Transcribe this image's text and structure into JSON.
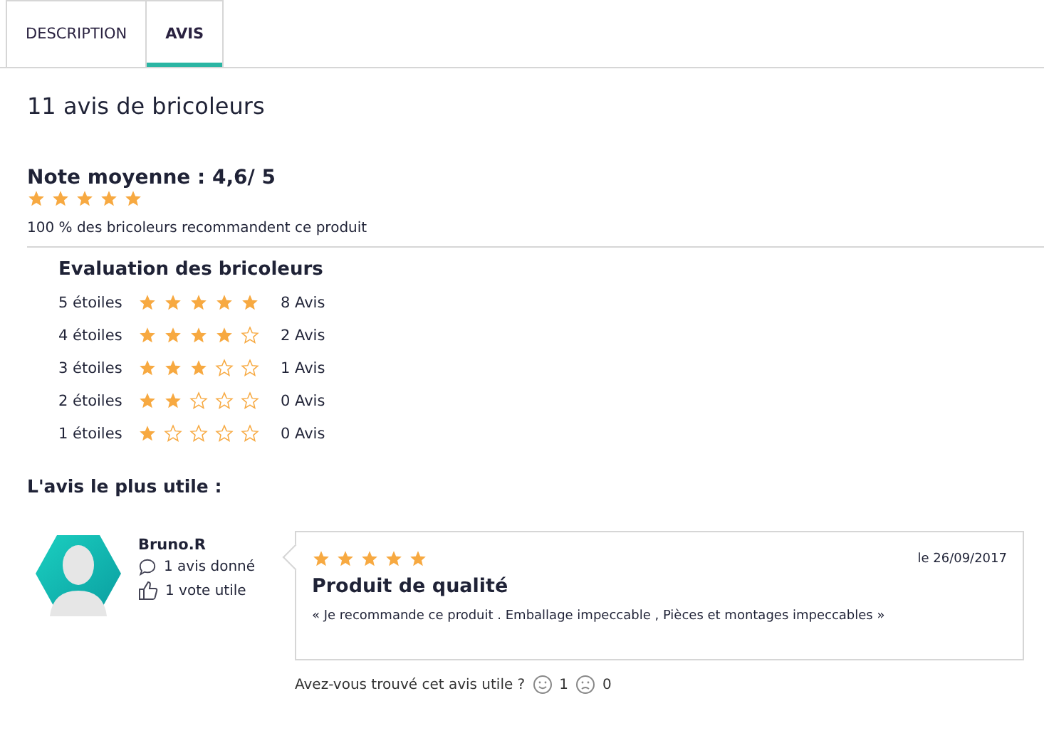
{
  "tabs": [
    {
      "label": "DESCRIPTION",
      "selected": false
    },
    {
      "label": "AVIS",
      "selected": true
    }
  ],
  "heading": "11 avis de bricoleurs",
  "average": {
    "title": "Note moyenne : 4,6/ 5",
    "stars": 5,
    "recommend": "100 % des bricoleurs recommandent ce produit"
  },
  "breakdown": {
    "title": "Evaluation des bricoleurs",
    "rows": [
      {
        "label": "5 étoiles",
        "stars": 5,
        "count": "8 Avis"
      },
      {
        "label": "4 étoiles",
        "stars": 4,
        "count": "2 Avis"
      },
      {
        "label": "3 étoiles",
        "stars": 3,
        "count": "1 Avis"
      },
      {
        "label": "2 étoiles",
        "stars": 2,
        "count": "0 Avis"
      },
      {
        "label": "1 étoiles",
        "stars": 1,
        "count": "0 Avis"
      }
    ]
  },
  "most_useful": {
    "title": "L'avis le plus utile :",
    "author": {
      "name": "Bruno.R",
      "reviews": "1 avis donné",
      "votes": "1 vote utile"
    },
    "review": {
      "stars": 5,
      "date": "le 26/09/2017",
      "title": "Produit de qualité",
      "text": "« Je recommande ce produit . Emballage impeccable , Pièces et montages impeccables »"
    },
    "feedback": {
      "question": "Avez-vous trouvé cet avis utile ?",
      "yes": "1",
      "no": "0"
    }
  }
}
